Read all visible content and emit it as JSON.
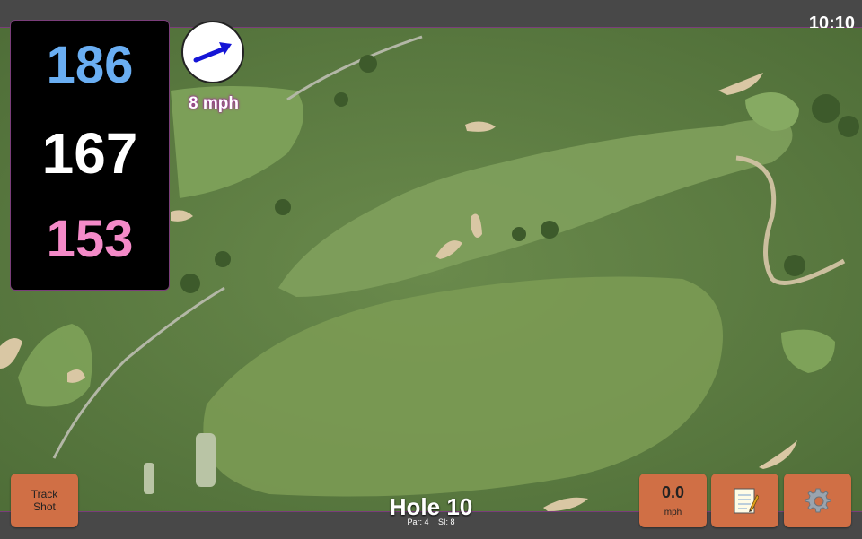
{
  "status_bar": {
    "time": "10:10"
  },
  "distances": {
    "back": "186",
    "middle": "167",
    "front": "153"
  },
  "wind": {
    "speed_label": "8 mph",
    "icon": "wind-arrow-icon"
  },
  "buttons": {
    "track_shot": {
      "line1": "Track",
      "line2": "Shot"
    },
    "speed": {
      "value": "0.0",
      "unit": "mph"
    },
    "notes_icon": "notes-icon",
    "settings_icon": "gear-icon"
  },
  "hole": {
    "title": "Hole 10",
    "par_label": "Par: 4",
    "si_label": "SI: 8"
  },
  "colors": {
    "accent": "#d06f45",
    "back_distance": "#6aaef2",
    "front_distance": "#f48ac8"
  }
}
